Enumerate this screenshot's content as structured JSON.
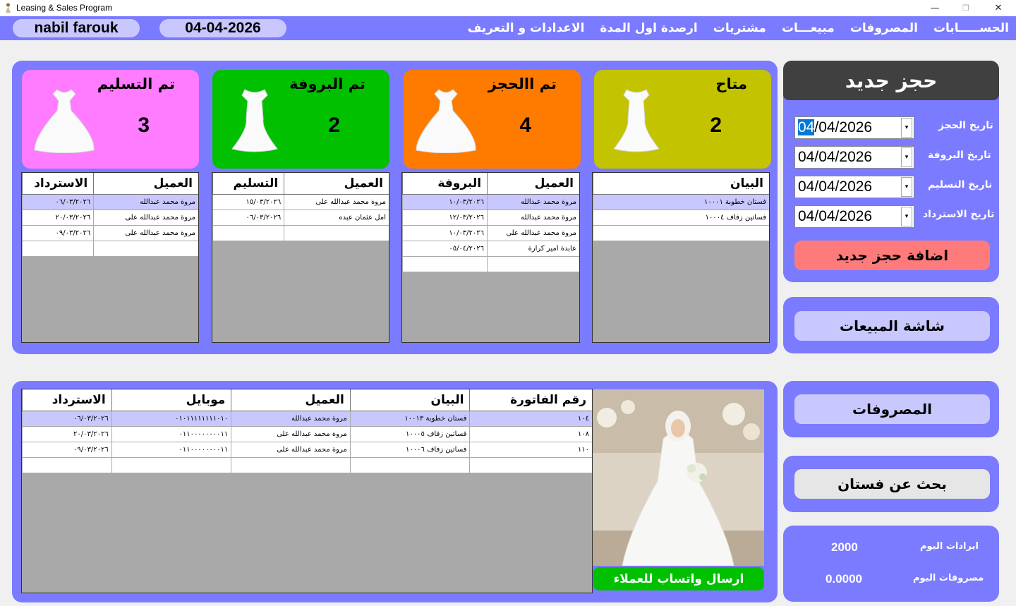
{
  "window": {
    "title": "Leasing & Sales Program",
    "minimize": "—",
    "maximize": "❐",
    "close": "✕"
  },
  "header": {
    "user": "nabil farouk",
    "date": "04-04-2026",
    "menu": [
      "الاعدادات و التعريف",
      "ارصدة اول المدة",
      "مشتريات",
      "مبيعـــات",
      "المصروفات",
      "الحســـــابات"
    ]
  },
  "colors": {
    "accent": "#7b7bff",
    "pill": "#c8c8ff",
    "available": "#c3c300",
    "booked": "#ff7b00",
    "fitting": "#00c000",
    "delivered": "#ff7bff"
  },
  "cards": [
    {
      "title": "متاح",
      "count": "2",
      "color": "#c3c300"
    },
    {
      "title": "تم االحجز",
      "count": "4",
      "color": "#ff7b00"
    },
    {
      "title": "تم البروفة",
      "count": "2",
      "color": "#00c000"
    },
    {
      "title": "تم التسليم",
      "count": "3",
      "color": "#ff7bff"
    }
  ],
  "grids": {
    "available": {
      "headers": [
        "البيان"
      ],
      "rows": [
        [
          "فستان خطوبة ١٠٠٠١"
        ],
        [
          "فساتين زفاف ١٠٠٠٤"
        ],
        [
          ""
        ]
      ]
    },
    "booked": {
      "headers": [
        "العميل",
        "البروفة"
      ],
      "rows": [
        [
          "مروة محمد عبدالله",
          "١٠/٠٣/٢٠٢٦"
        ],
        [
          "مروة محمد عبدالله",
          "١٢/٠٣/٢٠٢٦"
        ],
        [
          "مروة محمد عبدالله على",
          "١٠/٠٣/٢٠٢٦"
        ],
        [
          "عابدة امير كرارة",
          "٠٥/٠٤/٢٠٢٦"
        ],
        [
          "",
          ""
        ]
      ]
    },
    "fitting": {
      "headers": [
        "العميل",
        "التسليم"
      ],
      "rows": [
        [
          "مروة محمد عبدالله على",
          "١٥/٠٣/٢٠٢٦"
        ],
        [
          "امل عثمان عبده",
          "٠٦/٠٣/٢٠٢٦"
        ],
        [
          "",
          ""
        ]
      ]
    },
    "delivered": {
      "headers": [
        "العميل",
        "الاسترداد"
      ],
      "rows": [
        [
          "مروة محمد عبدالله",
          "٠٦/٠٣/٢٠٢٦"
        ],
        [
          "مروة محمد عبدالله على",
          "٢٠/٠٣/٢٠٢٦"
        ],
        [
          "مروة محمد عبدالله على",
          "٠٩/٠٣/٢٠٢٦"
        ],
        [
          "",
          ""
        ]
      ]
    },
    "invoices": {
      "headers": [
        "رقم الفاتورة",
        "البيان",
        "العميل",
        "موبايل",
        "الاسترداد"
      ],
      "rows": [
        [
          "١٠٤",
          "فستان خطوبة ١٠٠١٣",
          "مروة محمد عبدالله",
          "٠١٠١١١١١١١١٠١٠",
          "٠٦/٠٣/٢٠٢٦"
        ],
        [
          "١٠٨",
          "فساتين زفاف ١٠٠٠٥",
          "مروة محمد عبدالله على",
          "٠١١٠٠٠٠٠٠٠٠١١",
          "٢٠/٠٣/٢٠٢٦"
        ],
        [
          "١١٠",
          "فساتين زفاف ١٠٠٠٦",
          "مروة محمد عبدالله على",
          "٠١١٠٠٠٠٠٠٠٠١١",
          "٠٩/٠٣/٢٠٢٦"
        ],
        [
          "",
          "",
          "",
          "",
          ""
        ]
      ]
    }
  },
  "booking": {
    "title": "حجز جديد",
    "fields": [
      {
        "label": "تاريخ الحجز",
        "value_hl": "04",
        "value_rest": "/04/2026"
      },
      {
        "label": "تاريخ البروفة",
        "value_hl": "",
        "value_rest": "04/04/2026"
      },
      {
        "label": "تاريخ التسليم",
        "value_hl": "",
        "value_rest": "04/04/2026"
      },
      {
        "label": "تاريخ الاسترداد",
        "value_hl": "",
        "value_rest": "04/04/2026"
      }
    ],
    "add_button": "اضافة حجز جديد"
  },
  "sales_button": "شاشة المبيعات",
  "expenses_button": "المصروفات",
  "search_button": "بحث عن فستان",
  "whatsapp_button": "ارسال واتساب للعملاء",
  "stats": {
    "revenue_label": "ايرادات اليوم",
    "revenue": "2000",
    "expenses_label": "مصروفات اليوم",
    "expenses": "0.0000"
  }
}
